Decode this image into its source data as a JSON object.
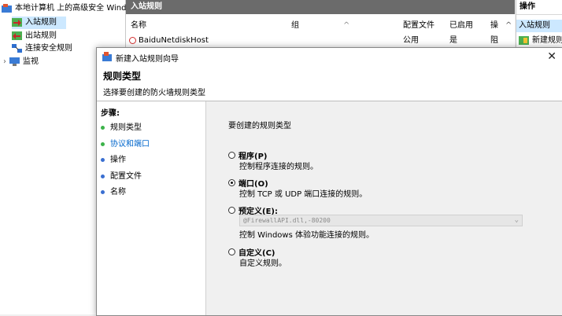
{
  "tree": {
    "root": "本地计算机 上的高级安全 Wind",
    "items": [
      "入站规则",
      "出站规则",
      "连接安全规则",
      "监视"
    ]
  },
  "center": {
    "header": "入站规则",
    "columns": [
      "名称",
      "组",
      "配置文件",
      "已启用",
      "操"
    ],
    "row": {
      "name": "BaiduNetdiskHost",
      "profile": "公用",
      "enabled": "是",
      "action": "阻"
    }
  },
  "actions": {
    "header": "操作",
    "sub": "入站规则",
    "item": "新建规则"
  },
  "wizard": {
    "title": "新建入站规则向导",
    "heading": "规则类型",
    "subtitle": "选择要创建的防火墙规则类型",
    "steps_title": "步骤:",
    "steps": [
      "规则类型",
      "协议和端口",
      "操作",
      "配置文件",
      "名称"
    ],
    "question": "要创建的规则类型",
    "options": [
      {
        "label": "程序(P)",
        "desc": "控制程序连接的规则。",
        "selected": false
      },
      {
        "label": "端口(O)",
        "desc": "控制 TCP 或 UDP 端口连接的规则。",
        "selected": true
      },
      {
        "label": "预定义(E):",
        "desc": "控制 Windows 体验功能连接的规则。",
        "selected": false,
        "dropdown": "@FirewallAPI.dll,-80200"
      },
      {
        "label": "自定义(C)",
        "desc": "自定义规则。",
        "selected": false
      }
    ]
  },
  "colors": {
    "accent_link": "#0066cc",
    "step_done": "#3cb34a",
    "step_pending": "#3a6fd1",
    "selection": "#cce8ff"
  }
}
